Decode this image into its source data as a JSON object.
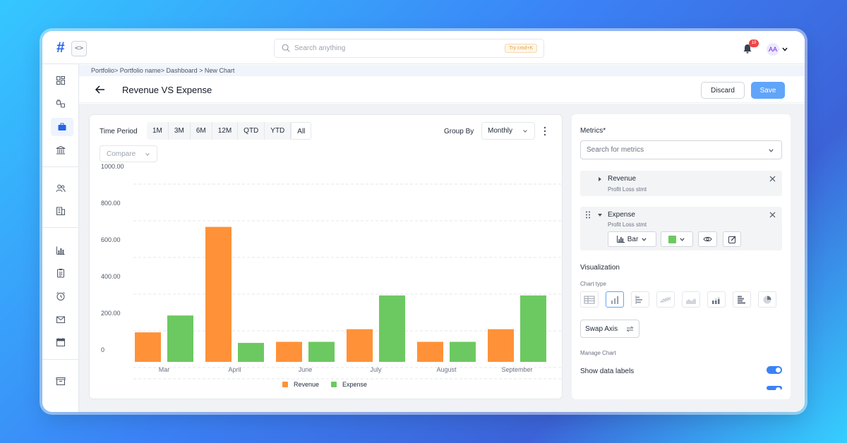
{
  "app": {
    "logo": "#",
    "code_toggle": "<>"
  },
  "search": {
    "placeholder": "Search anything",
    "shortcut": "Try cmd+K"
  },
  "notifications": {
    "count": "19"
  },
  "user": {
    "initials": "AA"
  },
  "breadcrumb": "Portfolio> Portfolio name>   Dashboard > New Chart",
  "header": {
    "title": "Revenue VS Expense",
    "discard_label": "Discard",
    "save_label": "Save"
  },
  "toolbar": {
    "time_period_label": "Time Period",
    "periods": [
      "1M",
      "3M",
      "6M",
      "12M",
      "QTD",
      "YTD",
      "All"
    ],
    "selected_period": "All",
    "group_by_label": "Group By",
    "group_by_value": "Monthly",
    "compare_label": "Compare"
  },
  "chart_data": {
    "type": "bar",
    "categories": [
      "Mar",
      "April",
      "June",
      "July",
      "August",
      "September"
    ],
    "series": [
      {
        "name": "Revenue",
        "color": "#ff9238",
        "values": [
          140,
          640,
          95,
          155,
          95,
          155
        ]
      },
      {
        "name": "Expense",
        "color": "#6cc961",
        "values": [
          220,
          90,
          95,
          315,
          95,
          315
        ]
      }
    ],
    "y_ticks": [
      "1000.00",
      "800.00",
      "600.00",
      "400.00",
      "200.00",
      "0"
    ],
    "ylim": [
      0,
      1000
    ],
    "grid": true,
    "legend": "bottom"
  },
  "panel": {
    "metrics_label": "Metrics*",
    "metrics_placeholder": "Search for metrics",
    "metrics": [
      {
        "name": "Revenue",
        "source": "Profit Loss stmt"
      },
      {
        "name": "Expense",
        "source": "Profit Loss stmt",
        "chart_type": "Bar",
        "color": "#6cc961"
      }
    ],
    "visualization_label": "Visualization",
    "chart_type_label": "Chart type",
    "chart_types": [
      "table-icon",
      "column-chart-icon",
      "horizontal-bar-icon",
      "line-chart-icon",
      "area-chart-icon",
      "stacked-column-icon",
      "stacked-bar-icon",
      "pie-chart-icon"
    ],
    "selected_chart_type": "column-chart-icon",
    "swap_axis_label": "Swap Axis",
    "manage_chart_label": "Manage Chart",
    "show_data_labels_label": "Show data labels",
    "show_data_labels": true
  }
}
